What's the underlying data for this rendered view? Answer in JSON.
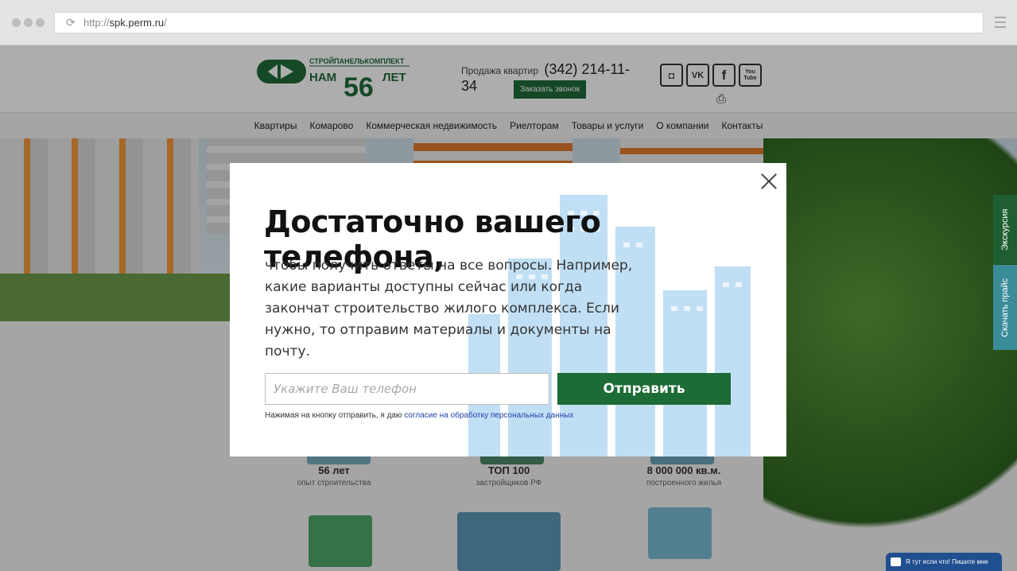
{
  "browser": {
    "url_scheme": "http://",
    "url_host": "spk.perm.ru",
    "url_path": "/"
  },
  "header": {
    "logo_top": "СТРОЙПАНЕЛЬКОМПЛЕКТ",
    "logo_main_left": "НАМ",
    "logo_main_num": "56",
    "logo_main_right": "ЛЕТ",
    "phone_label": "Продажа квартир",
    "phone": "(342) 214-11-34",
    "callback_label": "Заказать звонок",
    "socials": [
      {
        "name": "instagram-icon",
        "glyph": "◘"
      },
      {
        "name": "vk-icon",
        "glyph": "VK"
      },
      {
        "name": "facebook-icon",
        "glyph": "f"
      },
      {
        "name": "youtube-icon",
        "glyph": "You Tube"
      }
    ],
    "print_glyph": "⎙"
  },
  "nav": {
    "items": [
      "Квартиры",
      "Комарово",
      "Коммерческая недвижимость",
      "Риелторам",
      "Товары и услуги",
      "О компании",
      "Контакты"
    ]
  },
  "stats": [
    {
      "value": "56 лет",
      "caption": "опыт строительства"
    },
    {
      "value": "ТОП 100",
      "caption": "застройщиков РФ"
    },
    {
      "value": "8 000 000 кв.м.",
      "caption": "построенного жилья"
    }
  ],
  "side_tabs": {
    "excursion": "Экскурсия",
    "price": "Скачать прайс"
  },
  "chat": {
    "label": "Я тут если что! Пишите мне"
  },
  "modal": {
    "title": "Достаточно вашего телефона,",
    "text": "чтобы получить ответы на все вопросы. Например, какие варианты доступны сейчас или когда закончат строительство жилого комплекса. Если нужно, то отправим материалы и документы на почту.",
    "phone_placeholder": "Укажите Ваш телефон",
    "submit_label": "Отправить",
    "consent_prefix": "Нажимая на кнопку отправить, я даю",
    "consent_link": "согласие на обработку персональных данных"
  },
  "colors": {
    "brand_green": "#1d6b35",
    "tab_excursion": "#1f5e33",
    "tab_price": "#3b8c99",
    "chat_blue": "#1f4f8f",
    "art_blue": "#8ec5ec"
  }
}
